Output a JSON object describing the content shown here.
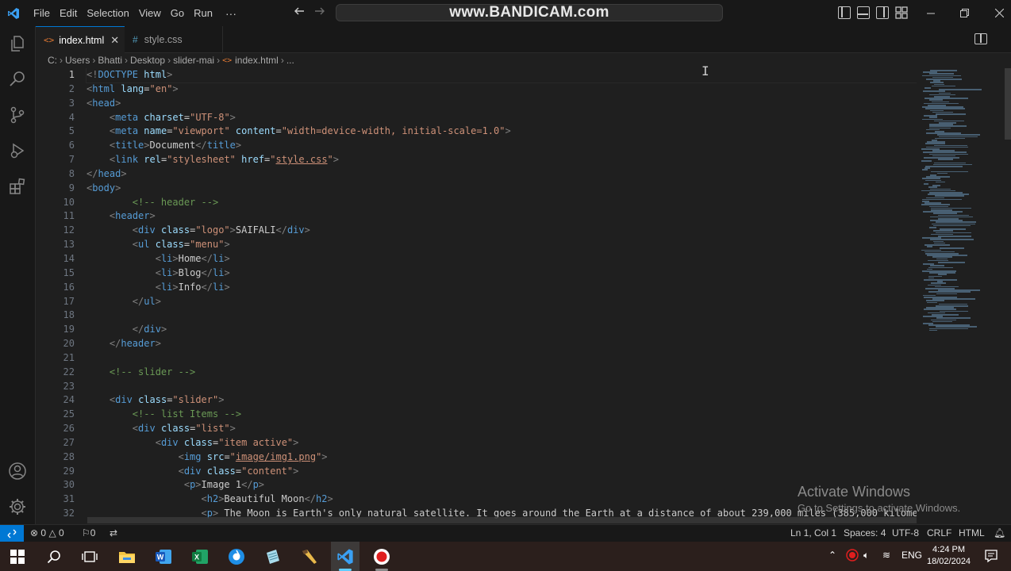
{
  "titlebar": {
    "menu": [
      "File",
      "Edit",
      "Selection",
      "View",
      "Go",
      "Run"
    ],
    "more": "···",
    "watermark": "www.BANDICAM.com"
  },
  "tabs": [
    {
      "label": "index.html",
      "icon": "html-file-icon",
      "active": true
    },
    {
      "label": "style.css",
      "icon": "css-file-icon",
      "active": false
    }
  ],
  "breadcrumb": [
    "C:",
    "Users",
    "Bhatti",
    "Desktop",
    "slider-mai",
    "index.html",
    "..."
  ],
  "editor": {
    "line_numbers": [
      "1",
      "2",
      "3",
      "4",
      "5",
      "6",
      "7",
      "8",
      "9",
      "10",
      "11",
      "12",
      "13",
      "14",
      "15",
      "16",
      "17",
      "18",
      "19",
      "20",
      "21",
      "22",
      "23",
      "24",
      "25",
      "26",
      "27",
      "28",
      "29",
      "30",
      "31",
      "32"
    ],
    "current_line": 1
  },
  "activate_windows": {
    "title": "Activate Windows",
    "subtitle": "Go to Settings to activate Windows."
  },
  "statusbar": {
    "errors": "0",
    "warnings": "0",
    "ports": "0",
    "position": "Ln 1, Col 1",
    "spaces": "Spaces: 4",
    "encoding": "UTF-8",
    "eol": "CRLF",
    "language": "HTML"
  },
  "taskbar": {
    "language": "ENG",
    "time": "4:24 PM",
    "date": "18/02/2024"
  },
  "colors": {
    "accent": "#0078d4",
    "tag": "#569cd6",
    "attribute": "#9cdcfe",
    "string": "#ce9178",
    "comment": "#6a9955"
  }
}
